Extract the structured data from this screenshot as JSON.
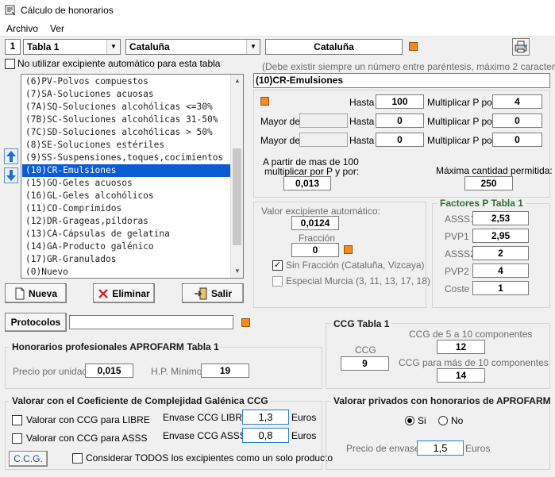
{
  "window": {
    "title": "Cálculo de honorarios"
  },
  "menu": {
    "file": "Archivo",
    "view": "Ver"
  },
  "toolbar": {
    "table_number": "1",
    "table_select": "Tabla 1",
    "region_select": "Cataluña",
    "region_display": "Cataluña"
  },
  "no_excipient_checkbox": "No utilizar excipiente automático para esta tabla",
  "list": {
    "items": [
      "(6)PV-Polvos compuestos",
      "(7)SA-Soluciones acuosas",
      "(7A)SQ-Soluciones alcohólicas <=30%",
      "(7B)SC-Soluciones alcohólicas 31-50%",
      "(7C)SD-Soluciones alcohólicas > 50%",
      "(8)SE-Soluciones estériles",
      "(9)SS-Suspensiones,toques,cocimientos",
      "(10)CR-Emulsiones",
      "(15)GQ-Geles acuosos",
      "(16)GL-Geles alcohólicos",
      "(11)CO-Comprimidos",
      "(12)DR-Grageas,píldoras",
      "(13)CA-Cápsulas de gelatina",
      "(14)GA-Producto galénico",
      "(17)GR-Granulados",
      "(0)Nuevo"
    ],
    "selected_index": 7
  },
  "buttons": {
    "new": "Nueva",
    "delete": "Eliminar",
    "exit": "Salir",
    "protocols": "Protocolos",
    "ccg": "C.C.G."
  },
  "protocols_value": "",
  "hint": "(Debe existir siempre un número entre paréntesis, máximo 2 caracteres)",
  "name_value": "(10)CR-Emulsiones",
  "multipliers": {
    "hasta_label": "Hasta",
    "mayor_label": "Mayor de",
    "mult_label": "Multiplicar P por:",
    "rows": [
      {
        "mayor": "",
        "hasta": "100",
        "mult": "4"
      },
      {
        "mayor": "",
        "hasta": "0",
        "mult": "0"
      },
      {
        "mayor": "",
        "hasta": "0",
        "mult": "0"
      }
    ]
  },
  "extra": {
    "from_label_1": "A partir de mas de 100",
    "from_label_2": "multiplicar por P y por:",
    "from_value": "0,013",
    "max_label": "Máxima cantidad permitida:",
    "max_value": "250"
  },
  "excipient": {
    "auto_label": "Valor excipiente automático:",
    "auto_value": "0,0124",
    "fraction_label": "Fracción",
    "fraction_value": "0",
    "sin_fraccion": "Sin Fracción (Cataluña, Vizcaya)",
    "murcia": "Especial Murcia (3, 11, 13, 17, 18)"
  },
  "factores": {
    "title": "Factores P Tabla 1",
    "items": [
      {
        "label": "ASSS1",
        "value": "2,53"
      },
      {
        "label": "PVP1",
        "value": "2,95"
      },
      {
        "label": "ASSS2",
        "value": "2"
      },
      {
        "label": "PVP2",
        "value": "4"
      },
      {
        "label": "Coste",
        "value": "1"
      }
    ]
  },
  "honorarios": {
    "title": "Honorarios profesionales APROFARM Tabla 1",
    "unit_price_label": "Precio por unidad:",
    "unit_price": "0,015",
    "hp_min_label": "H.P. Mínimo:",
    "hp_min": "19"
  },
  "ccg_tabla": {
    "title": "CCG Tabla 1",
    "ccg_label": "CCG",
    "ccg_value": "9",
    "c5_10_label": "CCG de 5 a 10 componentes",
    "c5_10_value": "12",
    "c10_label": "CCG para más de 10 componentes",
    "c10_value": "14"
  },
  "valorar_ccg": {
    "title": "Valorar con el Coeficiente de Complejidad Galénica CCG",
    "libre_check": "Valorar con CCG para LIBRE",
    "asss_check": "Valorar con CCG para ASSS",
    "envase_libre_label": "Envase CCG LIBRE:",
    "envase_libre_value": "1,3",
    "envase_asss_label": "Envase CCG ASSS:",
    "envase_asss_value": "0,8",
    "euros": "Euros",
    "todos_check": "Considerar TODOS los excipientes como un solo producto"
  },
  "privados": {
    "title": "Valorar privados con honorarios de APROFARM",
    "si": "Si",
    "no": "No",
    "precio_label": "Precio de envase:",
    "precio_value": "1,5",
    "euros": "Euros"
  }
}
